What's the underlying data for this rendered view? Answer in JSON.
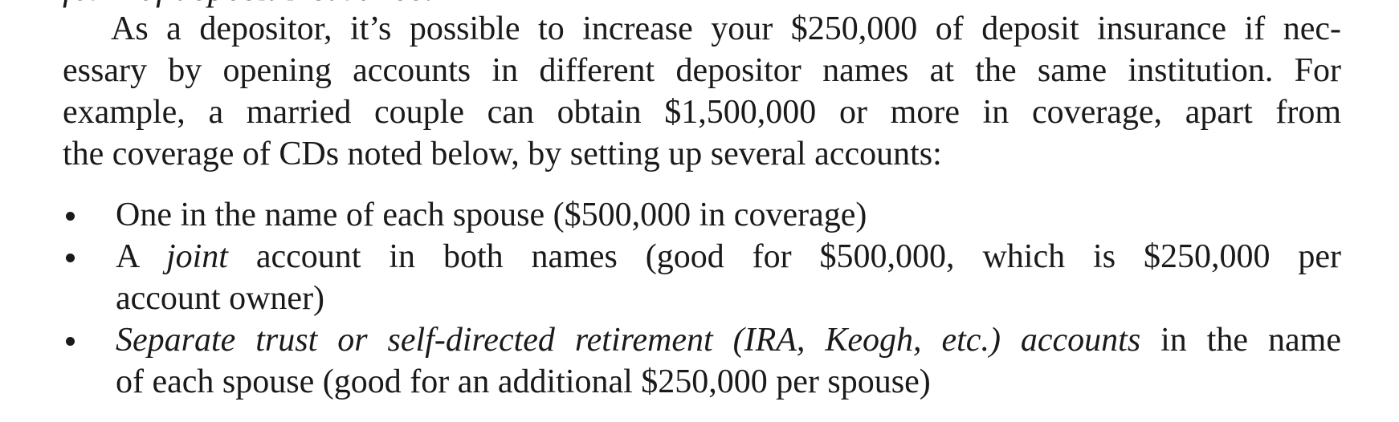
{
  "top_fragment": "form of deposit insurance.",
  "paragraph": {
    "lines": [
      "As a depositor, it’s possible to increase your $250,000 of deposit insurance if nec-",
      "essary by opening accounts in different depositor names at the same institution. For",
      "example, a married couple can obtain $1,500,000 or more in coverage, apart from",
      "the coverage of CDs noted below, by setting up several accounts:"
    ]
  },
  "bullets": [
    {
      "lines": [
        "One in the name of each spouse ($500,000 in coverage)"
      ]
    },
    {
      "pre": "A ",
      "italic": "joint",
      "post": " account in both names (good for $500,000, which is $250,000 per",
      "line2": "account owner)"
    },
    {
      "italic": "Separate trust or self-directed retirement (IRA, Keogh, etc.) accounts",
      "post": " in the name",
      "line2": "of each spouse (good for an additional $250,000 per spouse)"
    }
  ]
}
